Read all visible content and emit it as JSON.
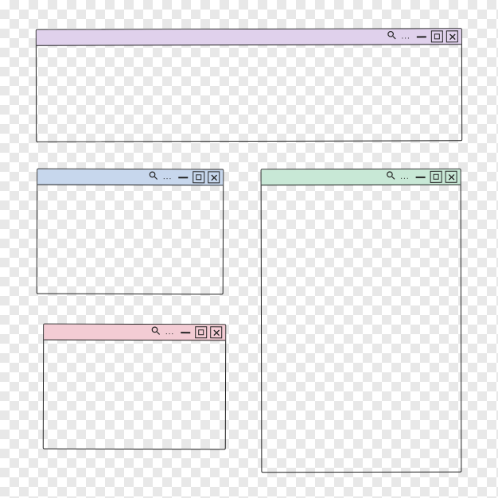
{
  "windows": [
    {
      "id": "win1",
      "color": "purple",
      "ellipsis": "..."
    },
    {
      "id": "win2",
      "color": "blue",
      "ellipsis": "..."
    },
    {
      "id": "win3",
      "color": "green",
      "ellipsis": "..."
    },
    {
      "id": "win4",
      "color": "pink",
      "ellipsis": "..."
    }
  ],
  "icons": {
    "search": "search-icon",
    "minimize": "minimize-icon",
    "maximize": "maximize-icon",
    "close": "close-icon"
  }
}
